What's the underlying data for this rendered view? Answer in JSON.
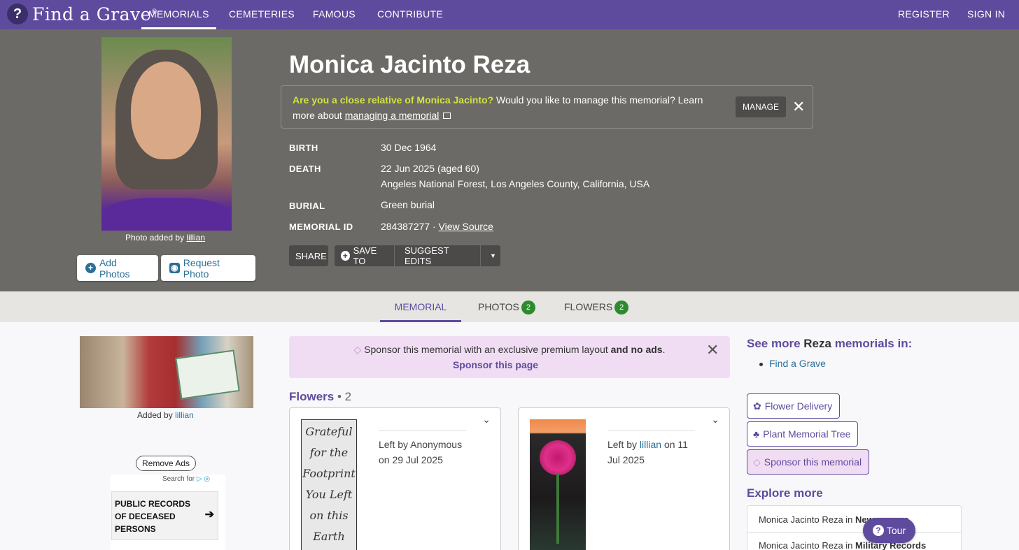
{
  "brand": {
    "name": "Find a Grave",
    "trademark": "®"
  },
  "nav": {
    "items": [
      "MEMORIALS",
      "CEMETERIES",
      "FAMOUS",
      "CONTRIBUTE"
    ],
    "register": "REGISTER",
    "sign_in": "SIGN IN"
  },
  "hero": {
    "photo_caption_prefix": "Photo added by",
    "photo_caption_user": "lillian",
    "add_photos": "Add Photos",
    "request_photo": "Request Photo",
    "name": "Monica Jacinto Reza",
    "manage_question": "Are you a close relative of Monica Jacinto?",
    "manage_text": "Would you like to manage this memorial? Learn more about",
    "manage_link": "managing a memorial",
    "manage_button": "MANAGE",
    "facts": {
      "birth_label": "BIRTH",
      "birth_value": "30 Dec 1964",
      "death_label": "DEATH",
      "death_value": "22 Jun 2025 (aged 60)",
      "death_place": "Angeles National Forest, Los Angeles County, California, USA",
      "burial_label": "BURIAL",
      "burial_value": "Green burial",
      "memorial_id_label": "MEMORIAL ID",
      "memorial_id_value": "284387277 ·",
      "view_source": "View Source"
    },
    "share": "SHARE",
    "save_to": "SAVE TO",
    "suggest_edits": "SUGGEST EDITS"
  },
  "tabs": {
    "memorial": "MEMORIAL",
    "photos": "PHOTOS",
    "photos_count": "2",
    "flowers": "FLOWERS",
    "flowers_count": "2"
  },
  "left": {
    "added_by_prefix": "Added by",
    "added_by_user": "lillian",
    "remove_ads": "Remove Ads",
    "ad_search_for": "Search for",
    "ad_title": "PUBLIC RECORDS OF DECEASED PERSONS"
  },
  "middle": {
    "sponsor_text": "Sponsor this memorial with an exclusive premium layout",
    "sponsor_bold": "and no ads",
    "sponsor_link": "Sponsor this page",
    "flowers_title": "Flowers",
    "flowers_count": "• 2",
    "flower1": {
      "poem_lines": [
        "Grateful",
        "for the",
        "Footprint",
        "You Left",
        "on this",
        "Earth"
      ],
      "left_by": "Left by Anonymous on 29 Jul 2025"
    },
    "flower2": {
      "left_by_prefix": "Left by",
      "left_by_user": "lillian",
      "left_by_suffix": "on 11 Jul 2025"
    }
  },
  "right": {
    "see_more_prefix": "See more",
    "see_more_name": "Reza",
    "see_more_suffix": "memorials in:",
    "find_a_grave_link": "Find a Grave",
    "flower_delivery": "Flower Delivery",
    "plant_tree": "Plant Memorial Tree",
    "sponsor_memorial": "Sponsor this memorial",
    "explore_more": "Explore more",
    "explore1_prefix": "Monica Jacinto Reza in",
    "explore1_bold": "Newspapers",
    "explore2_prefix": "Monica Jacinto Reza in",
    "explore2_bold": "Military Records",
    "tour": "Tour"
  },
  "colors": {
    "brand_purple": "#5f4b9d",
    "hero_gray": "#6b6a67",
    "highlight_yellow": "#d2e33b",
    "badge_green": "#2e8a2e",
    "sponsor_pink": "#f0ddf3",
    "link_blue": "#2a6f98"
  },
  "icons": [
    "question-logo-icon",
    "plus-circle-icon",
    "camera-icon",
    "external-link-icon",
    "close-icon",
    "caret-down-icon",
    "chevron-down-icon",
    "diamond-icon",
    "flower-icon",
    "tree-icon",
    "arrow-right-icon",
    "ad-choices-icon",
    "question-icon"
  ]
}
